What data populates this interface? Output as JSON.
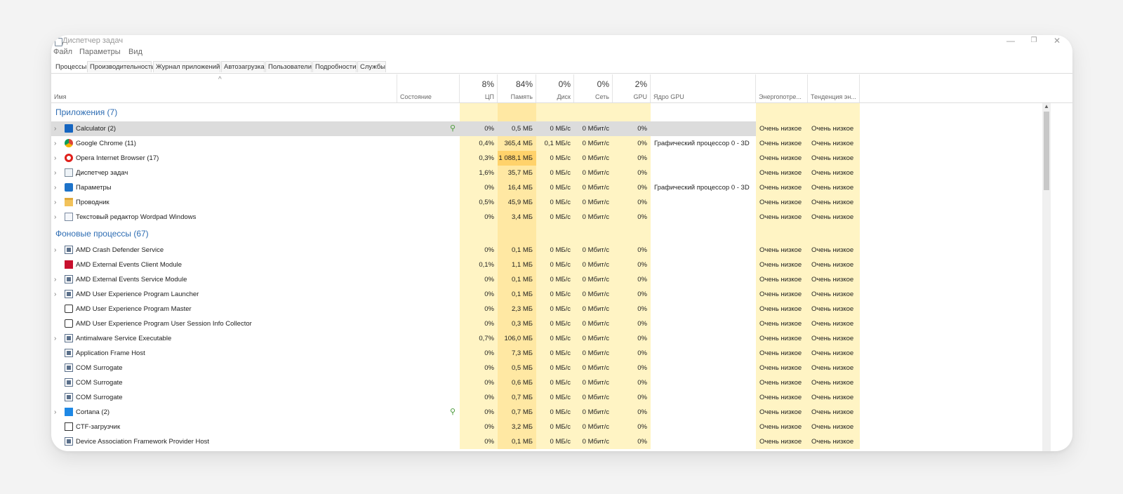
{
  "window": {
    "title": "Диспетчер задач"
  },
  "window_controls": {
    "minimize": "—",
    "maximize": "❐",
    "close": "✕"
  },
  "menu": [
    "Файл",
    "Параметры",
    "Вид"
  ],
  "tabs": [
    "Процессы",
    "Производительность",
    "Журнал приложений",
    "Автозагрузка",
    "Пользователи",
    "Подробности",
    "Службы"
  ],
  "active_tab": "Процессы",
  "header": {
    "sort_indicator": "^",
    "name": "Имя",
    "status": "Состояние",
    "cpu_pct": "8%",
    "cpu": "ЦП",
    "mem_pct": "84%",
    "mem": "Память",
    "disk_pct": "0%",
    "disk": "Диск",
    "net_pct": "0%",
    "net": "Сеть",
    "gpu_pct": "2%",
    "gpu": "GPU",
    "gpu_engine": "Ядро GPU",
    "power": "Энергопотре...",
    "power_trend": "Тенденция эн..."
  },
  "groups": [
    {
      "title": "Приложения (7)",
      "rows": [
        {
          "name": "Calculator (2)",
          "icon": "calculator-icon",
          "expand": true,
          "leaf": true,
          "selected": true,
          "cpu": "0%",
          "mem": "0,5 МБ",
          "disk": "0 МБ/с",
          "net": "0 Мбит/с",
          "gpu": "0%",
          "engine": "",
          "power": "Очень низкое",
          "trend": "Очень низкое"
        },
        {
          "name": "Google Chrome (11)",
          "icon": "chrome-icon",
          "expand": true,
          "cpu": "0,4%",
          "mem": "365,4 МБ",
          "disk": "0,1 МБ/с",
          "net": "0 Мбит/с",
          "gpu": "0%",
          "engine": "Графический процессор 0 - 3D",
          "power": "Очень низкое",
          "trend": "Очень низкое"
        },
        {
          "name": "Opera Internet Browser (17)",
          "icon": "opera-icon",
          "expand": true,
          "cpu": "0,3%",
          "mem": "1 088,1 МБ",
          "mem_hot": true,
          "disk": "0 МБ/с",
          "net": "0 Мбит/с",
          "gpu": "0%",
          "engine": "",
          "power": "Очень низкое",
          "trend": "Очень низкое"
        },
        {
          "name": "Диспетчер задач",
          "icon": "task-manager-icon",
          "expand": true,
          "cpu": "1,6%",
          "mem": "35,7 МБ",
          "disk": "0 МБ/с",
          "net": "0 Мбит/с",
          "gpu": "0%",
          "engine": "",
          "power": "Очень низкое",
          "trend": "Очень низкое"
        },
        {
          "name": "Параметры",
          "icon": "settings-gear-icon",
          "expand": true,
          "cpu": "0%",
          "mem": "16,4 МБ",
          "disk": "0 МБ/с",
          "net": "0 Мбит/с",
          "gpu": "0%",
          "engine": "Графический процессор 0 - 3D",
          "power": "Очень низкое",
          "trend": "Очень низкое"
        },
        {
          "name": "Проводник",
          "icon": "folder-icon",
          "expand": true,
          "cpu": "0,5%",
          "mem": "45,9 МБ",
          "disk": "0 МБ/с",
          "net": "0 Мбит/с",
          "gpu": "0%",
          "engine": "",
          "power": "Очень низкое",
          "trend": "Очень низкое"
        },
        {
          "name": "Текстовый редактор Wordpad Windows",
          "icon": "wordpad-icon",
          "expand": true,
          "cpu": "0%",
          "mem": "3,4 МБ",
          "disk": "0 МБ/с",
          "net": "0 Мбит/с",
          "gpu": "0%",
          "engine": "",
          "power": "Очень низкое",
          "trend": "Очень низкое"
        }
      ]
    },
    {
      "title": "Фоновые процессы (67)",
      "rows": [
        {
          "name": "AMD Crash Defender Service",
          "icon": "service-icon",
          "expand": true,
          "cpu": "0%",
          "mem": "0,1 МБ",
          "disk": "0 МБ/с",
          "net": "0 Мбит/с",
          "gpu": "0%",
          "engine": "",
          "power": "Очень низкое",
          "trend": "Очень низкое"
        },
        {
          "name": "AMD External Events Client Module",
          "icon": "amd-red-icon",
          "expand": false,
          "cpu": "0,1%",
          "mem": "1,1 МБ",
          "disk": "0 МБ/с",
          "net": "0 Мбит/с",
          "gpu": "0%",
          "engine": "",
          "power": "Очень низкое",
          "trend": "Очень низкое"
        },
        {
          "name": "AMD External Events Service Module",
          "icon": "service-icon",
          "expand": true,
          "cpu": "0%",
          "mem": "0,1 МБ",
          "disk": "0 МБ/с",
          "net": "0 Мбит/с",
          "gpu": "0%",
          "engine": "",
          "power": "Очень низкое",
          "trend": "Очень низкое"
        },
        {
          "name": "AMD User Experience Program Launcher",
          "icon": "service-icon",
          "expand": true,
          "cpu": "0%",
          "mem": "0,1 МБ",
          "disk": "0 МБ/с",
          "net": "0 Мбит/с",
          "gpu": "0%",
          "engine": "",
          "power": "Очень низкое",
          "trend": "Очень низкое"
        },
        {
          "name": "AMD User Experience Program Master",
          "icon": "people-icon",
          "expand": false,
          "cpu": "0%",
          "mem": "2,3 МБ",
          "disk": "0 МБ/с",
          "net": "0 Мбит/с",
          "gpu": "0%",
          "engine": "",
          "power": "Очень низкое",
          "trend": "Очень низкое"
        },
        {
          "name": "AMD User Experience Program User Session Info Collector",
          "icon": "people-icon",
          "expand": false,
          "cpu": "0%",
          "mem": "0,3 МБ",
          "disk": "0 МБ/с",
          "net": "0 Мбит/с",
          "gpu": "0%",
          "engine": "",
          "power": "Очень низкое",
          "trend": "Очень низкое"
        },
        {
          "name": "Antimalware Service Executable",
          "icon": "service-icon",
          "expand": true,
          "cpu": "0,7%",
          "mem": "106,0 МБ",
          "disk": "0 МБ/с",
          "net": "0 Мбит/с",
          "gpu": "0%",
          "engine": "",
          "power": "Очень низкое",
          "trend": "Очень низкое"
        },
        {
          "name": "Application Frame Host",
          "icon": "service-icon",
          "expand": false,
          "cpu": "0%",
          "mem": "7,3 МБ",
          "disk": "0 МБ/с",
          "net": "0 Мбит/с",
          "gpu": "0%",
          "engine": "",
          "power": "Очень низкое",
          "trend": "Очень низкое"
        },
        {
          "name": "COM Surrogate",
          "icon": "service-icon",
          "expand": false,
          "cpu": "0%",
          "mem": "0,5 МБ",
          "disk": "0 МБ/с",
          "net": "0 Мбит/с",
          "gpu": "0%",
          "engine": "",
          "power": "Очень низкое",
          "trend": "Очень низкое"
        },
        {
          "name": "COM Surrogate",
          "icon": "service-icon",
          "expand": false,
          "cpu": "0%",
          "mem": "0,6 МБ",
          "disk": "0 МБ/с",
          "net": "0 Мбит/с",
          "gpu": "0%",
          "engine": "",
          "power": "Очень низкое",
          "trend": "Очень низкое"
        },
        {
          "name": "COM Surrogate",
          "icon": "service-icon",
          "expand": false,
          "cpu": "0%",
          "mem": "0,7 МБ",
          "disk": "0 МБ/с",
          "net": "0 Мбит/с",
          "gpu": "0%",
          "engine": "",
          "power": "Очень низкое",
          "trend": "Очень низкое"
        },
        {
          "name": "Cortana (2)",
          "icon": "cortana-icon",
          "expand": true,
          "leaf": true,
          "cpu": "0%",
          "mem": "0,7 МБ",
          "disk": "0 МБ/с",
          "net": "0 Мбит/с",
          "gpu": "0%",
          "engine": "",
          "power": "Очень низкое",
          "trend": "Очень низкое"
        },
        {
          "name": "CTF-загрузчик",
          "icon": "ctf-icon",
          "expand": false,
          "cpu": "0%",
          "mem": "3,2 МБ",
          "disk": "0 МБ/с",
          "net": "0 Мбит/с",
          "gpu": "0%",
          "engine": "",
          "power": "Очень низкое",
          "trend": "Очень низкое"
        },
        {
          "name": "Device Association Framework Provider Host",
          "icon": "service-icon",
          "expand": false,
          "cpu": "0%",
          "mem": "0,1 МБ",
          "disk": "0 МБ/с",
          "net": "0 Мбит/с",
          "gpu": "0%",
          "engine": "",
          "power": "Очень низкое",
          "trend": "Очень низкое"
        }
      ]
    }
  ]
}
